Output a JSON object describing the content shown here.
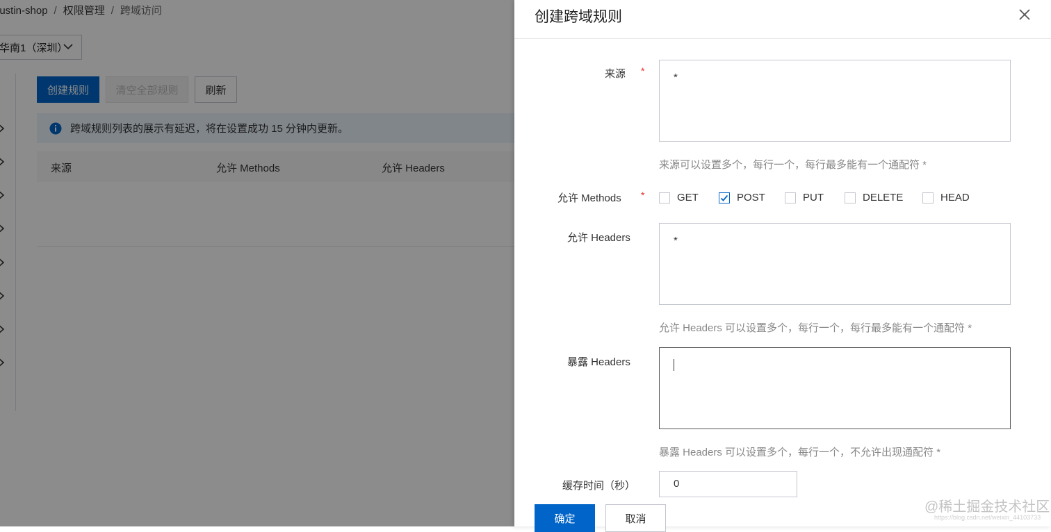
{
  "breadcrumb": {
    "bucket": "justin-shop",
    "section": "权限管理",
    "current": "跨域访问",
    "separator": "/"
  },
  "region": {
    "selected": "华南1（深圳）"
  },
  "toolbar": {
    "create_label": "创建规则",
    "clear_label": "清空全部规则",
    "refresh_label": "刷新"
  },
  "notice": {
    "text": "跨域规则列表的展示有延迟，将在设置成功 15 分钟内更新。"
  },
  "table": {
    "columns": [
      "来源",
      "允许 Methods",
      "允许 Headers"
    ]
  },
  "drawer": {
    "title": "创建跨域规则",
    "origin": {
      "label": "来源",
      "required": "*",
      "value": "*",
      "help": "来源可以设置多个，每行一个，每行最多能有一个通配符 *"
    },
    "methods": {
      "label": "允许 Methods",
      "required": "*",
      "options": [
        {
          "label": "GET",
          "checked": false
        },
        {
          "label": "POST",
          "checked": true
        },
        {
          "label": "PUT",
          "checked": false
        },
        {
          "label": "DELETE",
          "checked": false
        },
        {
          "label": "HEAD",
          "checked": false
        }
      ]
    },
    "allow_headers": {
      "label": "允许 Headers",
      "value": "*",
      "help": "允许 Headers 可以设置多个，每行一个，每行最多能有一个通配符 *"
    },
    "expose_headers": {
      "label": "暴露 Headers",
      "value": "",
      "help": "暴露 Headers 可以设置多个，每行一个，不允许出现通配符 *"
    },
    "max_age": {
      "label": "缓存时间（秒）",
      "value": "0"
    },
    "ok_label": "确定",
    "cancel_label": "取消"
  },
  "watermark": {
    "text": "@稀土掘金技术社区",
    "url": "https://blog.csdn.net/weixin_44103733"
  },
  "colors": {
    "primary": "#0064c8",
    "required": "#e72b23",
    "notice_bg": "#ebf4fd"
  }
}
